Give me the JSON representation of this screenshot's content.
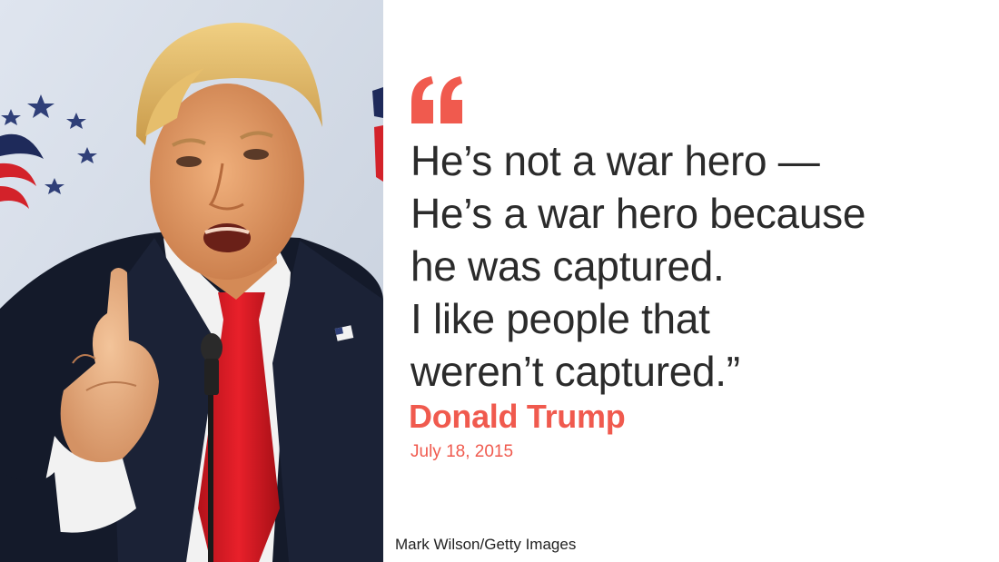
{
  "quote": {
    "lines": [
      "He’s not a war hero —",
      "He’s a war hero because",
      "he was captured.",
      "I like people that",
      "weren’t captured.”"
    ],
    "speaker": "Donald Trump",
    "date": "July 18, 2015"
  },
  "photo": {
    "credit": "Mark Wilson/Getty Images",
    "subject": "man speaking at microphone, index finger raised"
  },
  "colors": {
    "accent": "#f05a4e",
    "quote_text": "#2b2b2b",
    "background": "#ffffff"
  },
  "icons": {
    "quote_mark": "open-quote-icon"
  }
}
